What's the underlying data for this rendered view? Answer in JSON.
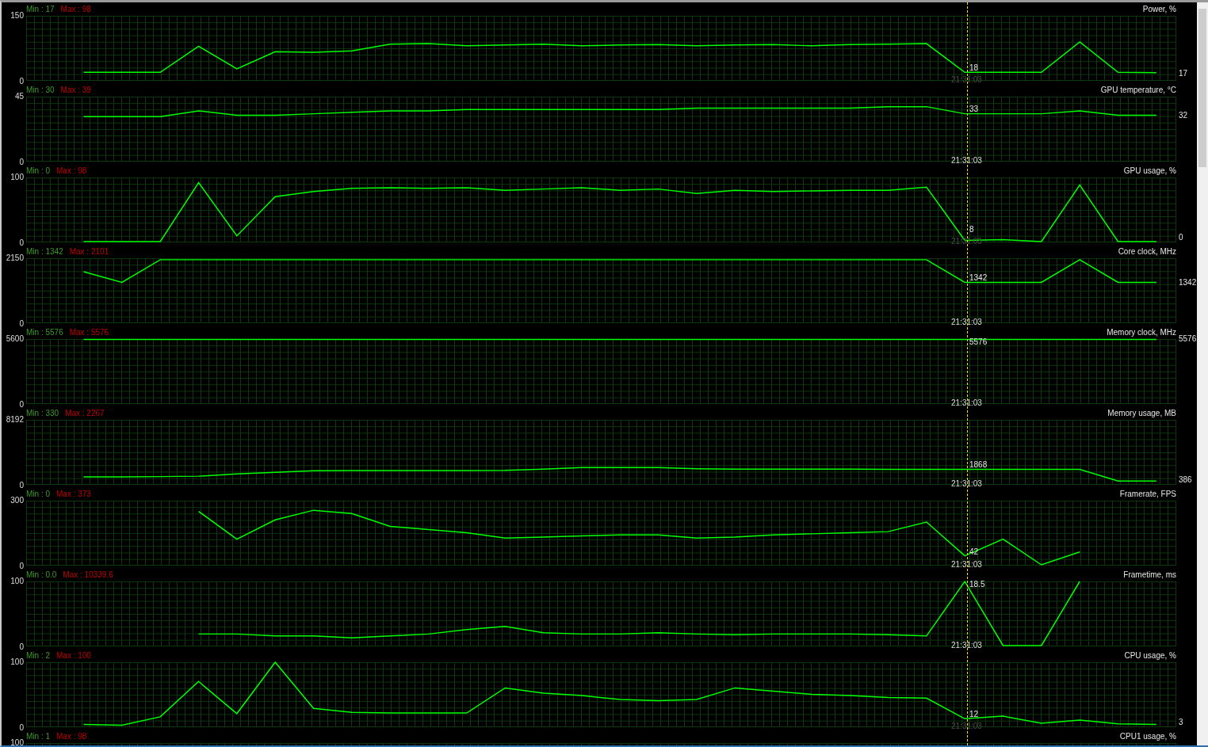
{
  "panels": [
    {
      "kind": "full",
      "min_label": "Min : 17",
      "max_label": "Max : 98",
      "cursor_value": "18",
      "cursor_time": "21:31:03",
      "time_dimmed": true,
      "current_value": "17",
      "chart_data": {
        "type": "line",
        "title": "Power, %",
        "ylim": [
          0,
          150
        ],
        "yticks": [
          0,
          150
        ],
        "values": [
          null,
          18,
          18,
          18,
          79,
          26,
          66,
          65,
          68,
          84,
          85,
          80,
          82,
          84,
          80,
          82,
          83,
          80,
          82,
          83,
          80,
          83,
          84,
          85,
          18,
          18,
          18,
          89,
          18,
          17
        ]
      }
    },
    {
      "kind": "full",
      "min_label": "Min : 30",
      "max_label": "Max : 39",
      "cursor_value": "33",
      "cursor_time": "21:31:03",
      "time_dimmed": false,
      "current_value": "32",
      "chart_data": {
        "type": "line",
        "title": "GPU temperature, °C",
        "ylim": [
          0,
          45
        ],
        "yticks": [
          0,
          45
        ],
        "values": [
          null,
          31,
          31,
          31,
          35,
          32,
          32,
          33,
          34,
          35,
          35,
          36,
          36,
          36,
          36,
          36,
          36,
          37,
          37,
          37,
          37,
          37,
          38,
          38,
          33,
          33,
          33,
          35,
          32,
          32
        ]
      }
    },
    {
      "kind": "full",
      "min_label": "Min : 0",
      "max_label": "Max : 98",
      "cursor_value": "8",
      "cursor_time": "21:31:03",
      "time_dimmed": true,
      "current_value": "0",
      "chart_data": {
        "type": "line",
        "title": "GPU usage, %",
        "ylim": [
          0,
          100
        ],
        "yticks": [
          0,
          100
        ],
        "values": [
          null,
          0,
          0,
          0,
          92,
          9,
          70,
          78,
          83,
          84,
          83,
          84,
          80,
          82,
          84,
          80,
          82,
          75,
          80,
          78,
          79,
          80,
          80,
          85,
          2,
          3,
          0,
          88,
          0,
          0
        ]
      }
    },
    {
      "kind": "full",
      "min_label": "Min : 1342",
      "max_label": "Max : 2101",
      "cursor_value": "1342",
      "cursor_time": "21:31:03",
      "time_dimmed": false,
      "current_value": "1342",
      "chart_data": {
        "type": "line",
        "title": "Core clock, MHz",
        "ylim": [
          0,
          2150
        ],
        "yticks": [
          0,
          2150
        ],
        "values": [
          null,
          1700,
          1342,
          2101,
          2101,
          2101,
          2101,
          2101,
          2101,
          2101,
          2101,
          2101,
          2101,
          2101,
          2101,
          2101,
          2101,
          2101,
          2101,
          2101,
          2101,
          2101,
          2101,
          2101,
          1342,
          1342,
          1342,
          2101,
          1342,
          1342
        ]
      }
    },
    {
      "kind": "full",
      "min_label": "Min : 5576",
      "max_label": "Max : 5576",
      "cursor_value": "5576",
      "cursor_time": "21:31:03",
      "time_dimmed": false,
      "current_value": "5576",
      "chart_data": {
        "type": "line",
        "title": "Memory clock, MHz",
        "ylim": [
          0,
          5600
        ],
        "yticks": [
          0,
          5600
        ],
        "values": [
          null,
          5576,
          5576,
          5576,
          5576,
          5576,
          5576,
          5576,
          5576,
          5576,
          5576,
          5576,
          5576,
          5576,
          5576,
          5576,
          5576,
          5576,
          5576,
          5576,
          5576,
          5576,
          5576,
          5576,
          5576,
          5576,
          5576,
          5576,
          5576,
          5576
        ]
      }
    },
    {
      "kind": "full",
      "min_label": "Min : 330",
      "max_label": "Max : 2267",
      "cursor_value": "1868",
      "cursor_time": "21:31:03",
      "time_dimmed": false,
      "current_value": "386",
      "chart_data": {
        "type": "line",
        "title": "Memory usage, MB",
        "ylim": [
          0,
          8192
        ],
        "yticks": [
          0,
          8192
        ],
        "values": [
          null,
          900,
          900,
          950,
          1000,
          1300,
          1500,
          1700,
          1720,
          1720,
          1720,
          1720,
          1750,
          1900,
          2100,
          2100,
          2100,
          1950,
          1900,
          1900,
          1900,
          1900,
          1880,
          1868,
          1868,
          1868,
          1868,
          1868,
          386,
          386
        ]
      }
    },
    {
      "kind": "full",
      "min_label": "Min : 0",
      "max_label": "Max : 373",
      "cursor_value": "42",
      "cursor_time": "21:31:03",
      "time_dimmed": false,
      "chart_data": {
        "type": "line",
        "title": "Framerate, FPS",
        "ylim": [
          0,
          300
        ],
        "yticks": [
          0,
          300
        ],
        "values": [
          null,
          null,
          null,
          null,
          250,
          120,
          210,
          255,
          240,
          180,
          165,
          150,
          125,
          130,
          135,
          140,
          140,
          125,
          130,
          140,
          145,
          150,
          155,
          200,
          42,
          120,
          0,
          60,
          null,
          null
        ]
      }
    },
    {
      "kind": "full",
      "min_label": "Min : 0.0",
      "max_label": "Max : 10339.6",
      "cursor_value": "18.5",
      "cursor_time": "21:31:03",
      "time_dimmed": false,
      "chart_data": {
        "type": "line",
        "title": "Frametime, ms",
        "ylim": [
          0,
          100
        ],
        "yticks": [
          0,
          100
        ],
        "values": [
          null,
          null,
          null,
          null,
          18,
          18,
          15,
          15,
          12,
          15,
          18,
          25,
          30,
          20,
          18,
          18,
          20,
          18,
          17,
          18,
          18,
          18,
          17,
          15,
          100,
          0,
          0,
          100,
          null,
          null
        ]
      }
    },
    {
      "kind": "full",
      "min_label": "Min : 2",
      "max_label": "Max : 100",
      "cursor_value": "12",
      "cursor_time": "21:31:03",
      "time_dimmed": true,
      "current_value": "3",
      "chart_data": {
        "type": "line",
        "title": "CPU usage, %",
        "ylim": [
          0,
          100
        ],
        "yticks": [
          0,
          100
        ],
        "values": [
          null,
          3,
          2,
          15,
          70,
          20,
          100,
          28,
          22,
          21,
          21,
          21,
          60,
          52,
          48,
          42,
          40,
          42,
          60,
          55,
          50,
          48,
          45,
          44,
          12,
          16,
          5,
          10,
          4,
          3
        ]
      }
    },
    {
      "kind": "partial",
      "min_label": "Min : 1",
      "max_label": "Max : 98",
      "title": "CPU1 usage, %",
      "top_tick": "100"
    }
  ]
}
